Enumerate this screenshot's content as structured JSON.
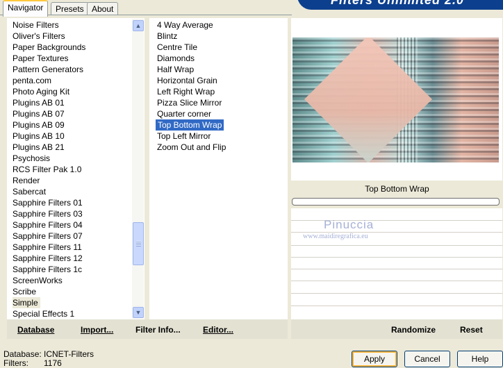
{
  "tabs": [
    {
      "label": "Navigator",
      "active": true
    },
    {
      "label": "Presets",
      "active": false
    },
    {
      "label": "About",
      "active": false
    }
  ],
  "brand": "Filters Unlimited 2.0",
  "categories": {
    "items": [
      "Noise Filters",
      "Oliver's Filters",
      "Paper Backgrounds",
      "Paper Textures",
      "Pattern Generators",
      "penta.com",
      "Photo Aging Kit",
      "Plugins AB 01",
      "Plugins AB 07",
      "Plugins AB 09",
      "Plugins AB 10",
      "Plugins AB 21",
      "Psychosis",
      "RCS Filter Pak 1.0",
      "Render",
      "Sabercat",
      "Sapphire Filters 01",
      "Sapphire Filters 03",
      "Sapphire Filters 04",
      "Sapphire Filters 07",
      "Sapphire Filters 11",
      "Sapphire Filters 12",
      "Sapphire Filters 1c",
      "ScreenWorks",
      "Scribe",
      "Simple",
      "Special Effects 1"
    ],
    "selected": "Simple"
  },
  "scrollbar": {
    "up_icon": "arrow-up-icon",
    "down_icon": "arrow-down-icon"
  },
  "filters": {
    "items": [
      "4 Way Average",
      "Blintz",
      "Centre Tile",
      "Diamonds",
      "Half Wrap",
      "Horizontal Grain",
      "Left Right Wrap",
      "Pizza Slice Mirror",
      "Quarter corner",
      "Top Bottom Wrap",
      "Top Left Mirror",
      "Zoom Out and Flip"
    ],
    "selected": "Top Bottom Wrap"
  },
  "preview": {
    "filter_name": "Top Bottom Wrap"
  },
  "watermark": {
    "name": "Pinuccia",
    "url": "www.maidiregrafica.eu"
  },
  "left_buttons": {
    "database": "Database",
    "import": "Import...",
    "filter_info": "Filter Info...",
    "editor": "Editor..."
  },
  "right_buttons": {
    "randomize": "Randomize",
    "reset": "Reset"
  },
  "status": {
    "database_label": "Database:",
    "database_value": "ICNET-Filters",
    "filters_label": "Filters:",
    "filters_value": "1176"
  },
  "dialog_buttons": {
    "apply": "Apply",
    "cancel": "Cancel",
    "help": "Help"
  },
  "colors": {
    "selection": "#316ac5",
    "banner": "#0c3f8e",
    "window": "#ece9d8"
  }
}
